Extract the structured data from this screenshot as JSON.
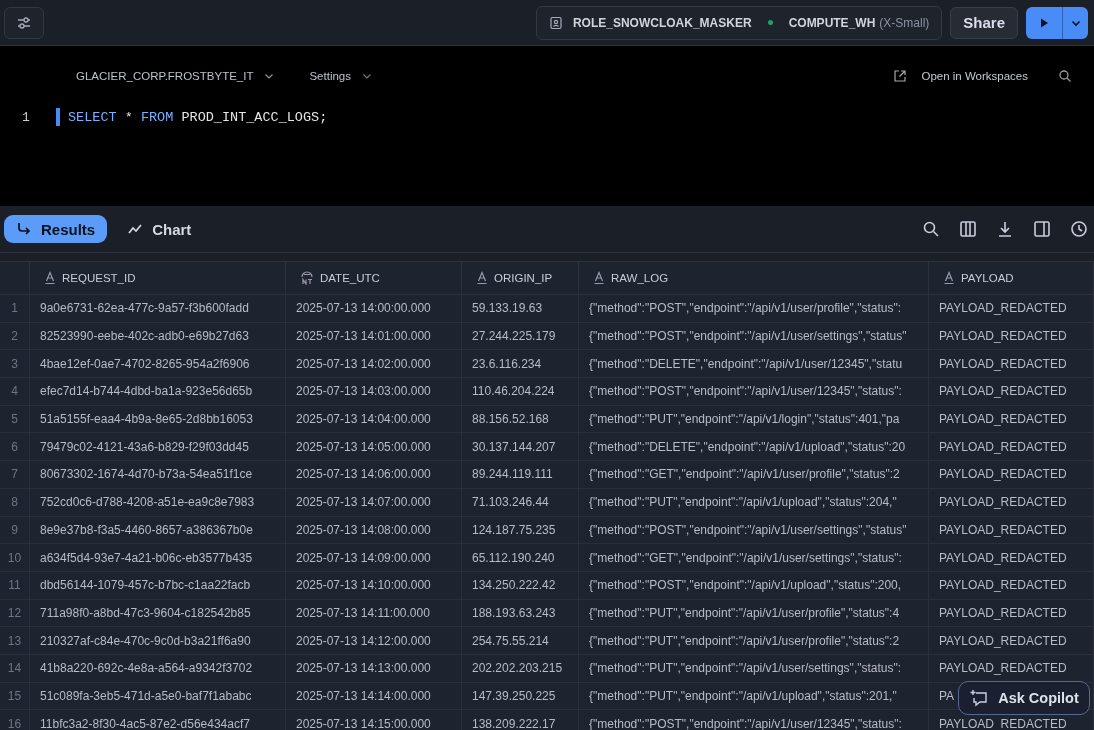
{
  "top_bar": {
    "role": "ROLE_SNOWCLOAK_MASKER",
    "warehouse": "COMPUTE_WH",
    "warehouse_size": "(X-Small)",
    "share": "Share"
  },
  "editor": {
    "database": "GLACIER_CORP.FROSTBYTE_IT",
    "settings": "Settings",
    "open_link": "Open in Workspaces",
    "lines": [
      {
        "number": "1",
        "tokens": [
          {
            "kind": "keyword",
            "text": "SELECT"
          },
          {
            "kind": "plain",
            "text": " * "
          },
          {
            "kind": "keyword",
            "text": "FROM"
          },
          {
            "kind": "plain",
            "text": " PROD_INT_ACC_LOGS;"
          }
        ]
      }
    ]
  },
  "results_tabs": [
    {
      "label": "Results",
      "selected": true
    },
    {
      "label": "Chart",
      "selected": false
    }
  ],
  "table": {
    "columns": [
      {
        "label": "REQUEST_ID",
        "kind": "text"
      },
      {
        "label": "DATE_UTC",
        "kind": "timestamp"
      },
      {
        "label": "ORIGIN_IP",
        "kind": "text"
      },
      {
        "label": "RAW_LOG",
        "kind": "text"
      },
      {
        "label": "PAYLOAD",
        "kind": "text"
      }
    ],
    "rows": [
      {
        "number": "1",
        "cells": [
          "9a0e6731-62ea-477c-9a57-f3b600fadd",
          "2025-07-13 14:00:00.000",
          "59.133.19.63",
          "{\"method\":\"POST\",\"endpoint\":\"/api/v1/user/profile\",\"status\":",
          "PAYLOAD_REDACTED"
        ]
      },
      {
        "number": "2",
        "cells": [
          "82523990-eebe-402c-adb0-e69b27d63",
          "2025-07-13 14:01:00.000",
          "27.244.225.179",
          "{\"method\":\"POST\",\"endpoint\":\"/api/v1/user/settings\",\"status\"",
          "PAYLOAD_REDACTED"
        ]
      },
      {
        "number": "3",
        "cells": [
          "4bae12ef-0ae7-4702-8265-954a2f6906",
          "2025-07-13 14:02:00.000",
          "23.6.116.234",
          "{\"method\":\"DELETE\",\"endpoint\":\"/api/v1/user/12345\",\"statu",
          "PAYLOAD_REDACTED"
        ]
      },
      {
        "number": "4",
        "cells": [
          "efec7d14-b744-4dbd-ba1a-923e56d65b",
          "2025-07-13 14:03:00.000",
          "110.46.204.224",
          "{\"method\":\"POST\",\"endpoint\":\"/api/v1/user/12345\",\"status\":",
          "PAYLOAD_REDACTED"
        ]
      },
      {
        "number": "5",
        "cells": [
          "51a5155f-eaa4-4b9a-8e65-2d8bb16053",
          "2025-07-13 14:04:00.000",
          "88.156.52.168",
          "{\"method\":\"PUT\",\"endpoint\":\"/api/v1/login\",\"status\":401,\"pa",
          "PAYLOAD_REDACTED"
        ]
      },
      {
        "number": "6",
        "cells": [
          "79479c02-4121-43a6-b829-f29f03dd45",
          "2025-07-13 14:05:00.000",
          "30.137.144.207",
          "{\"method\":\"DELETE\",\"endpoint\":\"/api/v1/upload\",\"status\":20",
          "PAYLOAD_REDACTED"
        ]
      },
      {
        "number": "7",
        "cells": [
          "80673302-1674-4d70-b73a-54ea51f1ce",
          "2025-07-13 14:06:00.000",
          "89.244.119.111",
          "{\"method\":\"GET\",\"endpoint\":\"/api/v1/user/profile\",\"status\":2",
          "PAYLOAD_REDACTED"
        ]
      },
      {
        "number": "8",
        "cells": [
          "752cd0c6-d788-4208-a51e-ea9c8e7983",
          "2025-07-13 14:07:00.000",
          "71.103.246.44",
          "{\"method\":\"PUT\",\"endpoint\":\"/api/v1/upload\",\"status\":204,\"",
          "PAYLOAD_REDACTED"
        ]
      },
      {
        "number": "9",
        "cells": [
          "8e9e37b8-f3a5-4460-8657-a386367b0e",
          "2025-07-13 14:08:00.000",
          "124.187.75.235",
          "{\"method\":\"POST\",\"endpoint\":\"/api/v1/user/settings\",\"status\"",
          "PAYLOAD_REDACTED"
        ]
      },
      {
        "number": "10",
        "cells": [
          "a634f5d4-93e7-4a21-b06c-eb3577b435",
          "2025-07-13 14:09:00.000",
          "65.112.190.240",
          "{\"method\":\"GET\",\"endpoint\":\"/api/v1/user/settings\",\"status\":",
          "PAYLOAD_REDACTED"
        ]
      },
      {
        "number": "11",
        "cells": [
          "dbd56144-1079-457c-b7bc-c1aa22facb",
          "2025-07-13 14:10:00.000",
          "134.250.222.42",
          "{\"method\":\"POST\",\"endpoint\":\"/api/v1/upload\",\"status\":200,",
          "PAYLOAD_REDACTED"
        ]
      },
      {
        "number": "12",
        "cells": [
          "711a98f0-a8bd-47c3-9604-c182542b85",
          "2025-07-13 14:11:00.000",
          "188.193.63.243",
          "{\"method\":\"PUT\",\"endpoint\":\"/api/v1/user/profile\",\"status\":4",
          "PAYLOAD_REDACTED"
        ]
      },
      {
        "number": "13",
        "cells": [
          "210327af-c84e-470c-9c0d-b3a21ff6a90",
          "2025-07-13 14:12:00.000",
          "254.75.55.214",
          "{\"method\":\"PUT\",\"endpoint\":\"/api/v1/user/profile\",\"status\":2",
          "PAYLOAD_REDACTED"
        ]
      },
      {
        "number": "14",
        "cells": [
          "41b8a220-692c-4e8a-a564-a9342f3702",
          "2025-07-13 14:13:00.000",
          "202.202.203.215",
          "{\"method\":\"PUT\",\"endpoint\":\"/api/v1/user/settings\",\"status\":",
          "PAYLOAD_REDACTED"
        ]
      },
      {
        "number": "15",
        "cells": [
          "51c089fa-3eb5-471d-a5e0-baf7f1ababc",
          "2025-07-13 14:14:00.000",
          "147.39.250.225",
          "{\"method\":\"PUT\",\"endpoint\":\"/api/v1/upload\",\"status\":201,\"",
          "PA"
        ]
      },
      {
        "number": "16",
        "cells": [
          "11bfc3a2-8f30-4ac5-87e2-d56e434acf7",
          "2025-07-13 14:15:00.000",
          "138.209.222.17",
          "{\"method\":\"POST\",\"endpoint\":\"/api/v1/user/12345\",\"status\":",
          "PAYLOAD_REDACTED"
        ]
      }
    ]
  },
  "copilot": {
    "label": "Ask Copilot"
  }
}
